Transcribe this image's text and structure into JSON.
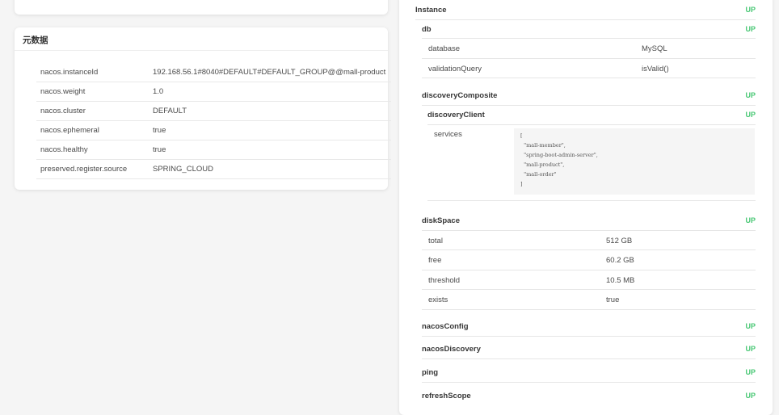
{
  "top_card": {
    "faded_text": ""
  },
  "metadata": {
    "title": "元数据",
    "rows": [
      {
        "key": "nacos.instanceId",
        "value": "192.168.56.1#8040#DEFAULT#DEFAULT_GROUP@@mall-product"
      },
      {
        "key": "nacos.weight",
        "value": "1.0"
      },
      {
        "key": "nacos.cluster",
        "value": "DEFAULT"
      },
      {
        "key": "nacos.ephemeral",
        "value": "true"
      },
      {
        "key": "nacos.healthy",
        "value": "true"
      },
      {
        "key": "preserved.register.source",
        "value": "SPRING_CLOUD"
      }
    ]
  },
  "health": {
    "instance": {
      "name": "Instance",
      "status": "UP"
    },
    "db": {
      "name": "db",
      "status": "UP",
      "rows": [
        {
          "key": "database",
          "value": "MySQL"
        },
        {
          "key": "validationQuery",
          "value": "isValid()"
        }
      ]
    },
    "discoveryComposite": {
      "name": "discoveryComposite",
      "status": "UP"
    },
    "discoveryClient": {
      "name": "discoveryClient",
      "status": "UP",
      "services_key": "services",
      "services_lines": [
        "[",
        "  \"mall-member\",",
        "  \"spring-boot-admin-server\",",
        "  \"mall-product\",",
        "  \"mall-order\"",
        "]"
      ]
    },
    "diskSpace": {
      "name": "diskSpace",
      "status": "UP",
      "rows": [
        {
          "key": "total",
          "value": "512 GB"
        },
        {
          "key": "free",
          "value": "60.2 GB"
        },
        {
          "key": "threshold",
          "value": "10.5 MB"
        },
        {
          "key": "exists",
          "value": "true"
        }
      ]
    },
    "nacosConfig": {
      "name": "nacosConfig",
      "status": "UP"
    },
    "nacosDiscovery": {
      "name": "nacosDiscovery",
      "status": "UP"
    },
    "ping": {
      "name": "ping",
      "status": "UP"
    },
    "refreshScope": {
      "name": "refreshScope",
      "status": "UP"
    }
  }
}
